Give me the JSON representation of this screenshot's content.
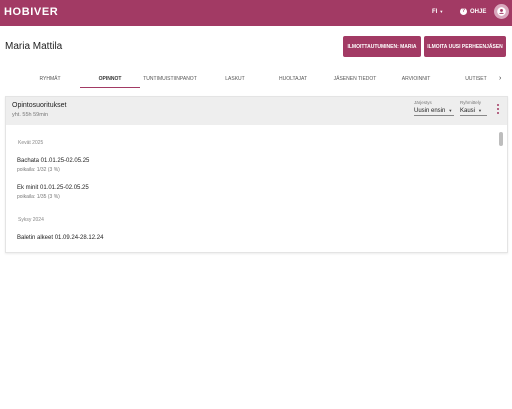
{
  "header": {
    "logo": "HOBIVER",
    "language": "FI",
    "help": "OHJE"
  },
  "user": {
    "name": "Maria Mattila"
  },
  "actions": {
    "register_label": "ILMOITTAUTUMINEN: MARIA",
    "new_family_member_label": "ILMOITA UUSI PERHEENJÄSEN"
  },
  "tabs": [
    {
      "label": "RYHMÄT"
    },
    {
      "label": "OPINNOT"
    },
    {
      "label": "TUNTIMUISTIINPANOT"
    },
    {
      "label": "LASKUT"
    },
    {
      "label": "HUOLTAJAT"
    },
    {
      "label": "JÄSENEN TIEDOT"
    },
    {
      "label": "ARVIOINNIT"
    },
    {
      "label": "UUTISET"
    }
  ],
  "active_tab": "OPINNOT",
  "card": {
    "title": "Opintosuoritukset",
    "subtitle": "yht. 55h 59min",
    "sort": {
      "label": "Järjestys",
      "value": "Uusin ensin"
    },
    "group": {
      "label": "Ryhmittely",
      "value": "Kausi"
    }
  },
  "sections": [
    {
      "heading": "Kevät 2025",
      "entries": [
        {
          "title": "Bachata 01.01.25-02.05.25",
          "detail": "poikaila: 1/32 (3 %)"
        },
        {
          "title": "Ek minit 01.01.25-02.05.25",
          "detail": "poikaila: 1/35 (3 %)"
        }
      ]
    },
    {
      "heading": "Syksy 2024",
      "entries": [
        {
          "title": "Baletin alkeet 01.09.24-28.12.24",
          "detail": ""
        }
      ]
    }
  ],
  "colors": {
    "brand": "#a23a64"
  }
}
